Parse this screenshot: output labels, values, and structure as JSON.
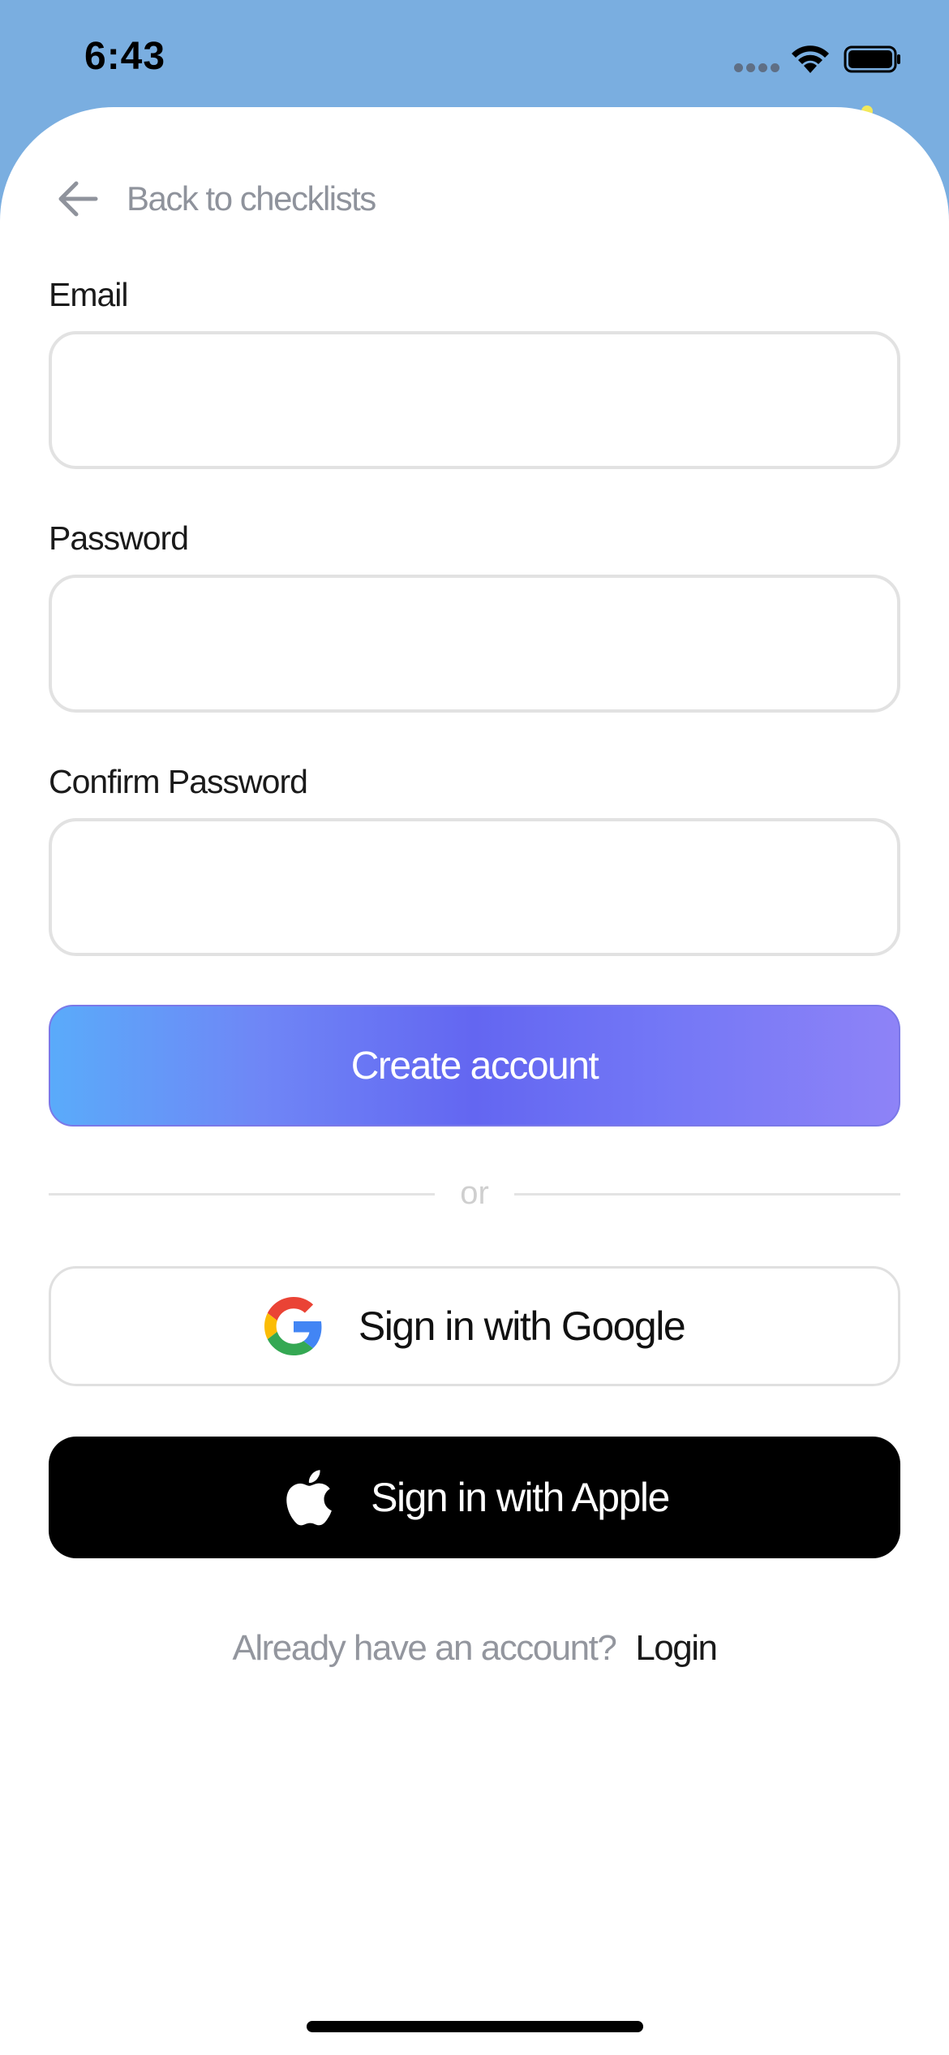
{
  "status_bar": {
    "time": "6:43",
    "signal_icon": "signal-dots-icon",
    "wifi_icon": "wifi-icon",
    "battery_icon": "battery-icon"
  },
  "nav": {
    "back_label": "Back to checklists",
    "back_icon": "arrow-left-icon"
  },
  "form": {
    "email_label": "Email",
    "email_value": "",
    "password_label": "Password",
    "password_value": "",
    "confirm_label": "Confirm Password",
    "confirm_value": ""
  },
  "actions": {
    "create_label": "Create account",
    "divider_text": "or",
    "google_label": "Sign in with Google",
    "google_icon": "google-g-icon",
    "apple_label": "Sign in with Apple",
    "apple_icon": "apple-logo-icon"
  },
  "footer": {
    "prompt": "Already have an account?",
    "login_label": "Login"
  },
  "colors": {
    "header_bg": "#7aaee0",
    "gradient_start": "#5aabfa",
    "gradient_mid": "#6366f1",
    "gradient_end": "#8e83f7",
    "apple_bg": "#000000"
  }
}
